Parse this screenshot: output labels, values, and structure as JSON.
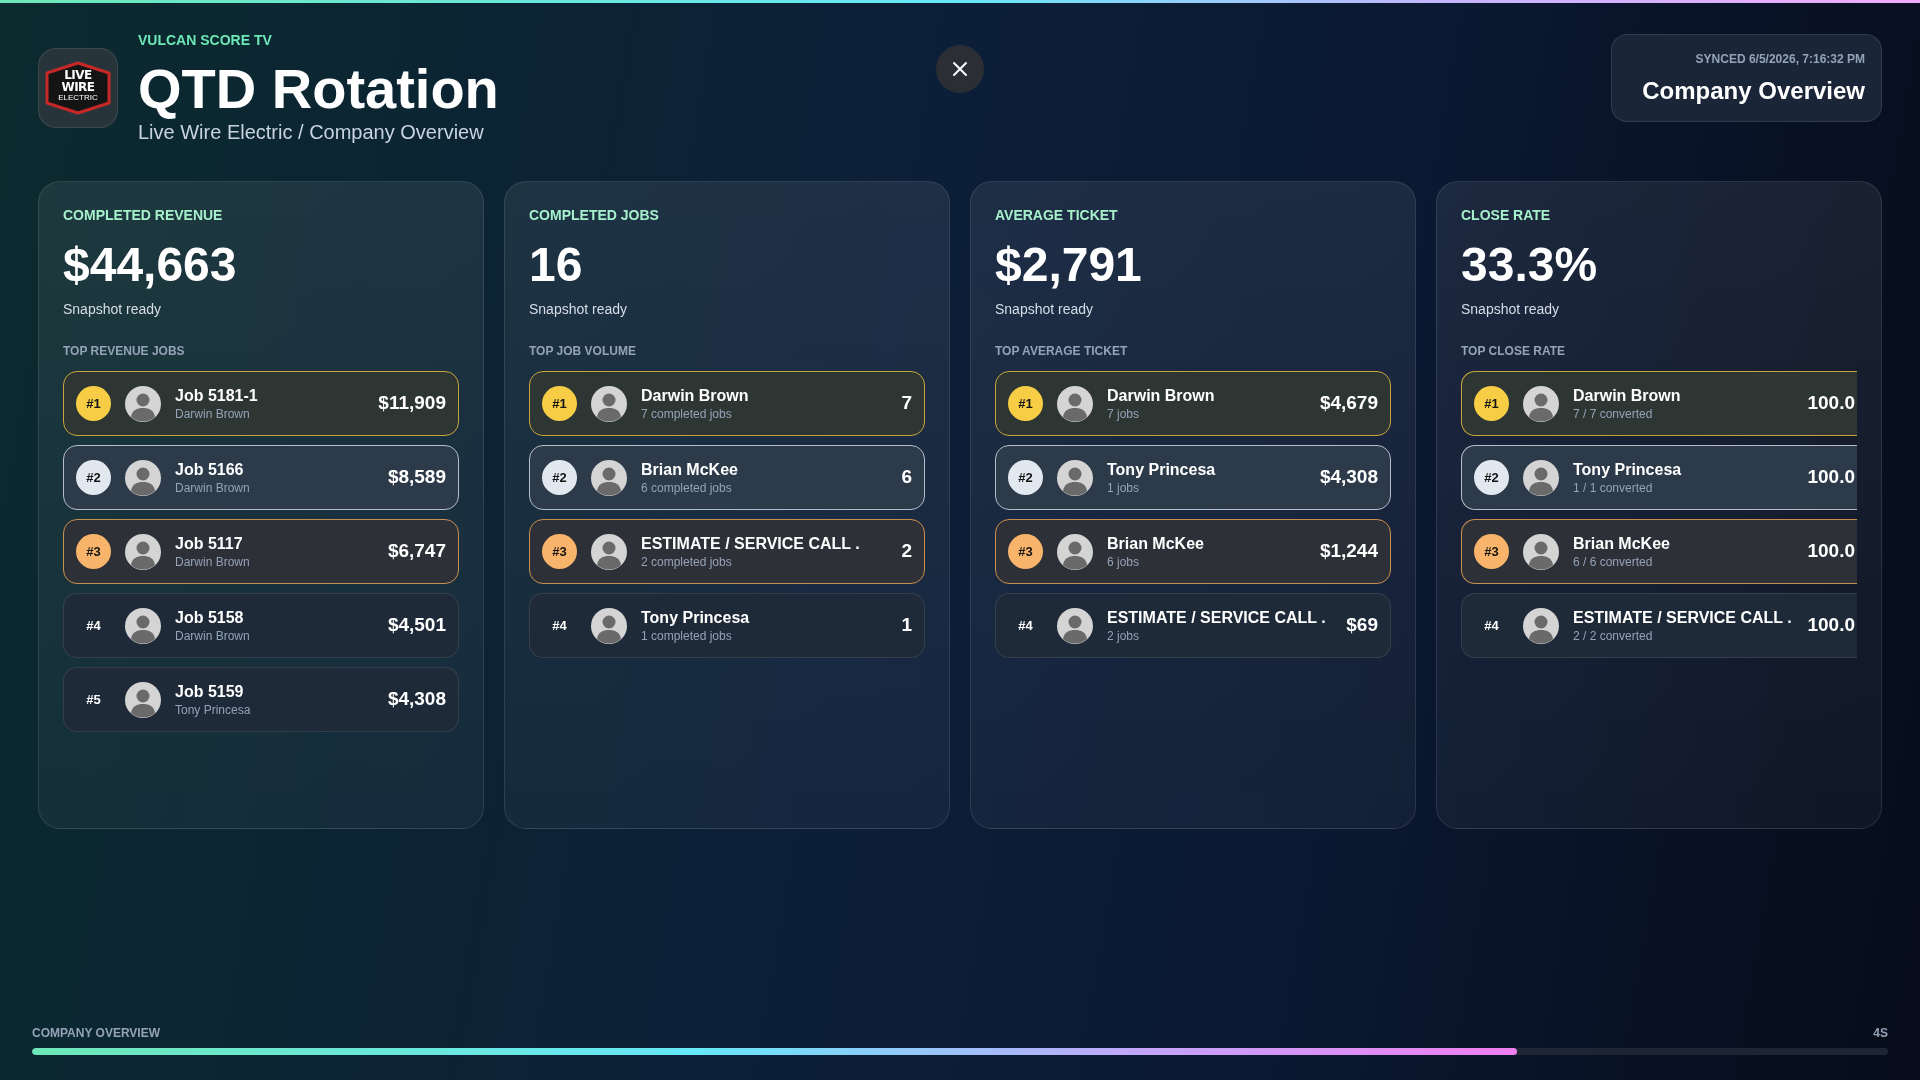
{
  "header": {
    "logo": {
      "wordmark": [
        "LIVE",
        "WIRE"
      ],
      "tagline": "ELECTRIC"
    },
    "eyebrow": "VULCAN SCORE TV",
    "title": "QTD Rotation",
    "subtitle": "Live Wire Electric / Company Overview"
  },
  "sync_panel": {
    "synced": "SYNCED 6/5/2026, 7:16:32 PM",
    "view": "Company Overview"
  },
  "cards": [
    {
      "label": "COMPLETED REVENUE",
      "value": "$44,663",
      "status": "Snapshot ready",
      "list_title": "TOP REVENUE JOBS",
      "clipped": false,
      "leaders": [
        {
          "kind": "gold",
          "rank": "#1",
          "name": "Job 5181-1",
          "detail": "Darwin Brown",
          "value": "$11,909"
        },
        {
          "kind": "silver",
          "rank": "#2",
          "name": "Job 5166",
          "detail": "Darwin Brown",
          "value": "$8,589"
        },
        {
          "kind": "bronze",
          "rank": "#3",
          "name": "Job 5117",
          "detail": "Darwin Brown",
          "value": "$6,747"
        },
        {
          "kind": "plain",
          "rank": "#4",
          "name": "Job 5158",
          "detail": "Darwin Brown",
          "value": "$4,501"
        },
        {
          "kind": "plain",
          "rank": "#5",
          "name": "Job 5159",
          "detail": "Tony Princesa",
          "value": "$4,308"
        }
      ]
    },
    {
      "label": "COMPLETED JOBS",
      "value": "16",
      "status": "Snapshot ready",
      "list_title": "TOP JOB VOLUME",
      "clipped": false,
      "leaders": [
        {
          "kind": "gold",
          "rank": "#1",
          "name": "Darwin Brown",
          "detail": "7 completed jobs",
          "value": "7"
        },
        {
          "kind": "silver",
          "rank": "#2",
          "name": "Brian McKee",
          "detail": "6 completed jobs",
          "value": "6"
        },
        {
          "kind": "bronze",
          "rank": "#3",
          "name": "ESTIMATE / SERVICE CALL .",
          "detail": "2 completed jobs",
          "value": "2"
        },
        {
          "kind": "plain",
          "rank": "#4",
          "name": "Tony Princesa",
          "detail": "1 completed jobs",
          "value": "1"
        }
      ]
    },
    {
      "label": "AVERAGE TICKET",
      "value": "$2,791",
      "status": "Snapshot ready",
      "list_title": "TOP AVERAGE TICKET",
      "clipped": false,
      "leaders": [
        {
          "kind": "gold",
          "rank": "#1",
          "name": "Darwin Brown",
          "detail": "7 jobs",
          "value": "$4,679"
        },
        {
          "kind": "silver",
          "rank": "#2",
          "name": "Tony Princesa",
          "detail": "1 jobs",
          "value": "$4,308"
        },
        {
          "kind": "bronze",
          "rank": "#3",
          "name": "Brian McKee",
          "detail": "6 jobs",
          "value": "$1,244"
        },
        {
          "kind": "plain",
          "rank": "#4",
          "name": "ESTIMATE / SERVICE CALL .",
          "detail": "2 jobs",
          "value": "$69"
        }
      ]
    },
    {
      "label": "CLOSE RATE",
      "value": "33.3%",
      "status": "Snapshot ready",
      "list_title": "TOP CLOSE RATE",
      "clipped": true,
      "leaders": [
        {
          "kind": "gold",
          "rank": "#1",
          "name": "Darwin Brown",
          "detail": "7 / 7 converted",
          "value": "100.0"
        },
        {
          "kind": "silver",
          "rank": "#2",
          "name": "Tony Princesa",
          "detail": "1 / 1 converted",
          "value": "100.0"
        },
        {
          "kind": "bronze",
          "rank": "#3",
          "name": "Brian McKee",
          "detail": "6 / 6 converted",
          "value": "100.0"
        },
        {
          "kind": "plain",
          "rank": "#4",
          "name": "ESTIMATE / SERVICE CALL .",
          "detail": "2 / 2 converted",
          "value": "100.0"
        }
      ]
    }
  ],
  "footer": {
    "label": "COMPANY OVERVIEW",
    "countdown": "4S",
    "progress": {
      "level": 0.8
    }
  }
}
